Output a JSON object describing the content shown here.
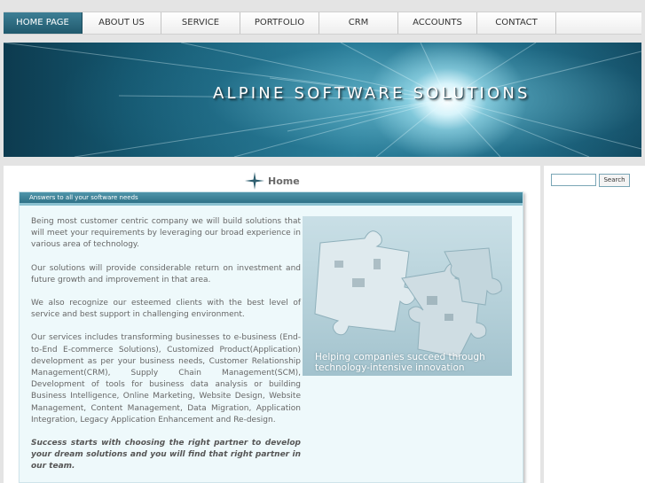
{
  "nav": {
    "items": [
      {
        "label": "HOME PAGE"
      },
      {
        "label": "ABOUT US"
      },
      {
        "label": "SERVICE"
      },
      {
        "label": "PORTFOLIO"
      },
      {
        "label": "CRM"
      },
      {
        "label": "ACCOUNTS"
      },
      {
        "label": "CONTACT"
      }
    ],
    "active_index": 0
  },
  "banner": {
    "title": "ALPINE SOFTWARE SOLUTIONS"
  },
  "main": {
    "heading": "Home",
    "heading_icon": "star-sparkle-icon",
    "bar_label": "Answers to all your software needs",
    "paragraphs": [
      "Being most customer centric company we will build solutions that will meet your requirements by leveraging our broad experience in various area of technology.",
      "Our solutions will provide considerable return on investment and future growth and improvement in that area.",
      "We also recognize our esteemed clients with the best level of service and best support in challenging environment.",
      "Our services includes transforming businesses to e-business (End-to-End E-commerce Solutions), Customized Product(Application) development as per your business needs, Customer Relationship Management(CRM), Supply Chain Management(SCM), Development of tools for business data analysis or building Business Intelligence, Online Marketing, Website Design, Website Management, Content Management, Data Migration, Application Integration, Legacy Application Enhancement and Re-design."
    ],
    "emphasis": "Success starts with choosing the right partner to develop your dream solutions and you will find that right partner in our team.",
    "image_caption_line1": "Helping companies succeed through",
    "image_caption_line2": "technology-intensive innovation"
  },
  "sidebar": {
    "search_value": "",
    "search_button": "Search"
  },
  "colors": {
    "nav_active": "#2b6b80",
    "content_bg": "#eef9fb",
    "bar": "#3f839a"
  }
}
